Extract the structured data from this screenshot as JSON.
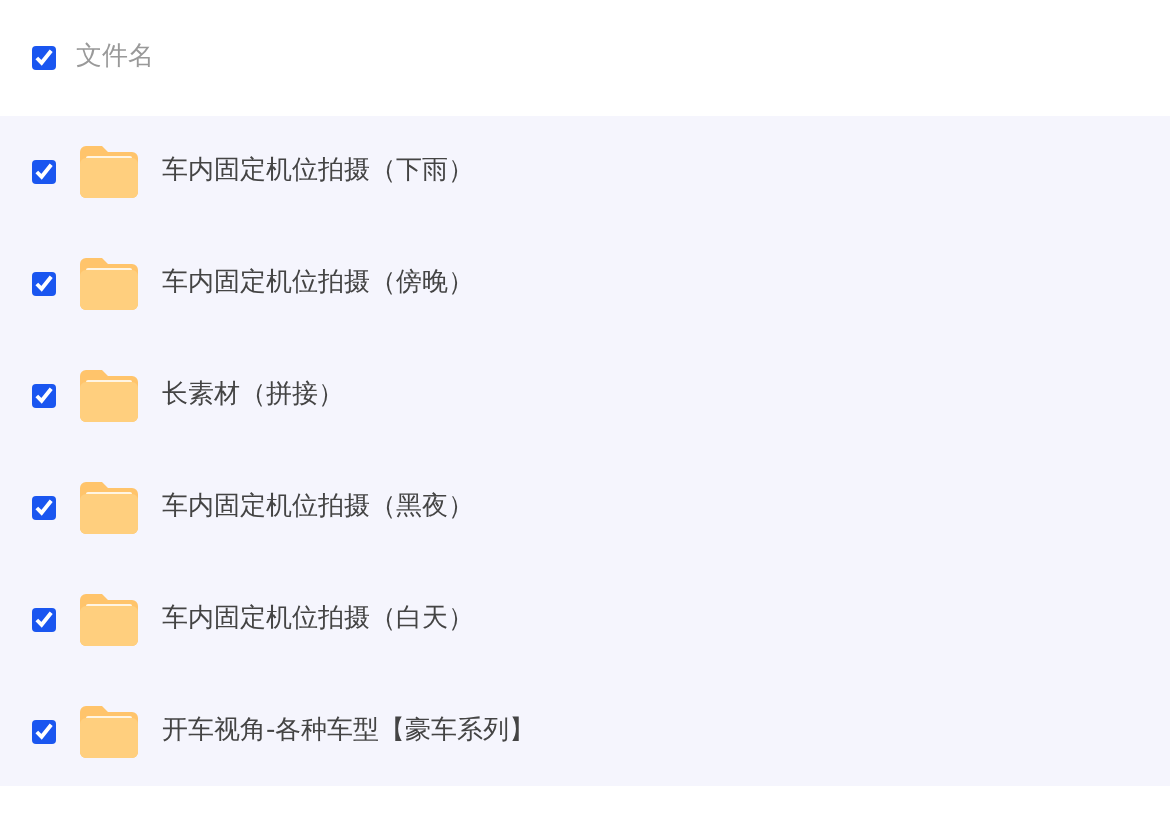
{
  "header": {
    "label": "文件名",
    "checked": true
  },
  "files": [
    {
      "name": "车内固定机位拍摄（下雨）",
      "checked": true
    },
    {
      "name": "车内固定机位拍摄（傍晚）",
      "checked": true
    },
    {
      "name": "长素材（拼接）",
      "checked": true
    },
    {
      "name": "车内固定机位拍摄（黑夜）",
      "checked": true
    },
    {
      "name": "车内固定机位拍摄（白天）",
      "checked": true
    },
    {
      "name": "开车视角-各种车型【豪车系列】",
      "checked": true
    }
  ]
}
